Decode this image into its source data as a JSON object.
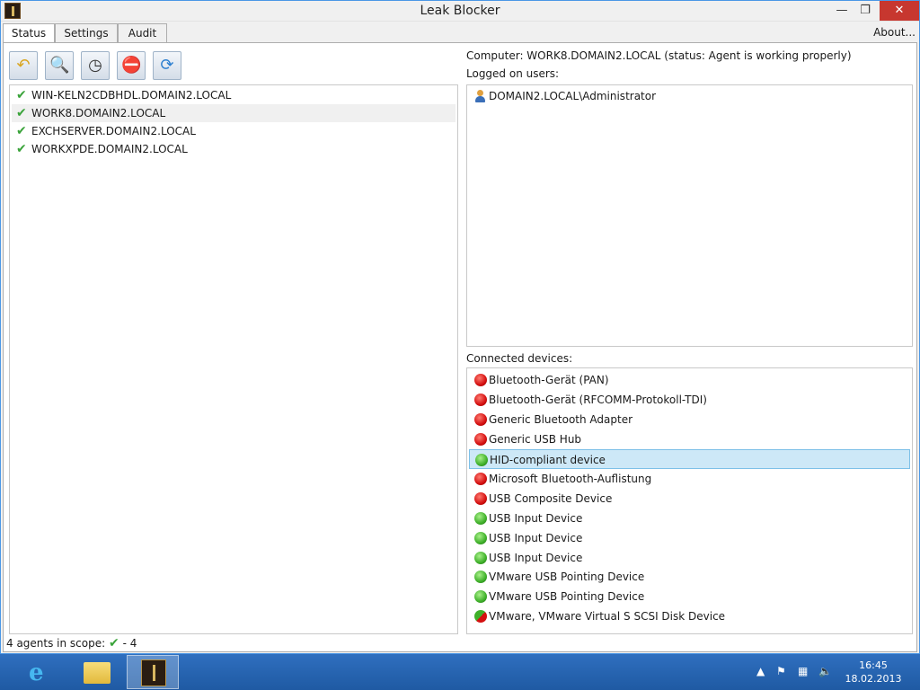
{
  "window": {
    "title": "Leak Blocker"
  },
  "tabs": [
    {
      "label": "Status"
    },
    {
      "label": "Settings"
    },
    {
      "label": "Audit"
    }
  ],
  "about_label": "About...",
  "toolbar": [
    {
      "icon": "undo-icon"
    },
    {
      "icon": "search-document-icon"
    },
    {
      "icon": "clock-icon"
    },
    {
      "icon": "clock-stop-icon"
    },
    {
      "icon": "refresh-icon"
    }
  ],
  "agents": [
    {
      "name": "WIN-KELN2CDBHDL.DOMAIN2.LOCAL"
    },
    {
      "name": "WORK8.DOMAIN2.LOCAL"
    },
    {
      "name": "EXCHSERVER.DOMAIN2.LOCAL"
    },
    {
      "name": "WORKXPDE.DOMAIN2.LOCAL"
    }
  ],
  "computer_line": "Computer: WORK8.DOMAIN2.LOCAL (status: Agent is working properly)",
  "logged_users_label": "Logged on users:",
  "users": [
    {
      "name": "DOMAIN2.LOCAL\\Administrator"
    }
  ],
  "devices_label": "Connected devices:",
  "devices": [
    {
      "name": "Bluetooth-Gerät (PAN)",
      "status": "red"
    },
    {
      "name": "Bluetooth-Gerät (RFCOMM-Protokoll-TDI)",
      "status": "red"
    },
    {
      "name": "Generic Bluetooth Adapter",
      "status": "red"
    },
    {
      "name": "Generic USB Hub",
      "status": "red"
    },
    {
      "name": "HID-compliant device",
      "status": "green"
    },
    {
      "name": "Microsoft Bluetooth-Auflistung",
      "status": "red"
    },
    {
      "name": "USB Composite Device",
      "status": "red"
    },
    {
      "name": "USB Input Device",
      "status": "green"
    },
    {
      "name": "USB Input Device",
      "status": "green"
    },
    {
      "name": "USB Input Device",
      "status": "green"
    },
    {
      "name": "VMware USB Pointing Device",
      "status": "green"
    },
    {
      "name": "VMware USB Pointing Device",
      "status": "green"
    },
    {
      "name": "VMware, VMware Virtual S SCSI Disk Device",
      "status": "mixed"
    }
  ],
  "statusbar": {
    "prefix": "4 agents in scope:",
    "suffix": "- 4"
  },
  "clock": {
    "time": "16:45",
    "date": "18.02.2013"
  }
}
